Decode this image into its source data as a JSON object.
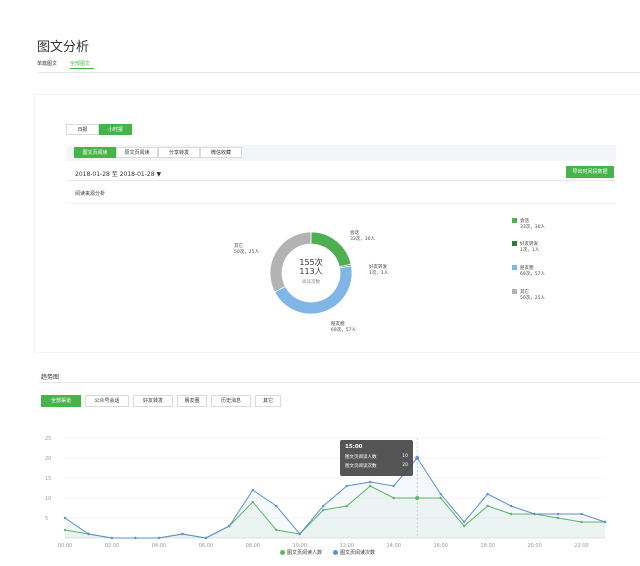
{
  "page": {
    "title": "图文分析"
  },
  "main_tabs": [
    {
      "label": "单篇图文",
      "active": false
    },
    {
      "label": "全部图文",
      "active": true
    }
  ],
  "period_buttons": [
    {
      "label": "日报",
      "active": false
    },
    {
      "label": "小时报",
      "active": true
    }
  ],
  "sub_tabs": [
    {
      "label": "图文页阅读",
      "active": true
    },
    {
      "label": "原文页阅读",
      "active": false
    },
    {
      "label": "分享转发",
      "active": false
    },
    {
      "label": "微信收藏",
      "active": false
    }
  ],
  "date_range": "2018-01-28 至 2018-01-28 ▼",
  "export_label": "导出时间段数据",
  "source_section": {
    "title": "阅读来源分析"
  },
  "donut": {
    "center_count": "155次",
    "center_people": "113人",
    "center_caption": "阅读次数",
    "slices": [
      {
        "name": "会话",
        "detail": "33次，30人",
        "value": 33,
        "color": "#4caf50"
      },
      {
        "name": "好友转发",
        "detail": "1次，1人",
        "value": 1,
        "color": "#2e7d32"
      },
      {
        "name": "朋友圈",
        "detail": "69次，57人",
        "value": 69,
        "color": "#7fb6e6"
      },
      {
        "name": "其它",
        "detail": "50次，25人",
        "value": 50,
        "color": "#b3b3b3"
      }
    ]
  },
  "trend": {
    "title": "趋势图",
    "tabs": [
      {
        "label": "全部渠道",
        "active": true
      },
      {
        "label": "公众号会话",
        "active": false
      },
      {
        "label": "好友转发",
        "active": false
      },
      {
        "label": "朋友圈",
        "active": false
      },
      {
        "label": "历史消息",
        "active": false
      },
      {
        "label": "其它",
        "active": false
      }
    ],
    "tooltip": {
      "time": "15:00",
      "rows": [
        {
          "label": "图文页阅读人数",
          "value": "10"
        },
        {
          "label": "图文页阅读次数",
          "value": "20"
        }
      ]
    },
    "legend": [
      {
        "label": "图文页阅读人数",
        "color": "#5cb85c"
      },
      {
        "label": "图文页阅读次数",
        "color": "#5b8fd6"
      }
    ]
  },
  "chart_data": {
    "type": "line",
    "title": "",
    "xlabel": "",
    "ylabel": "",
    "ylim": [
      0,
      25
    ],
    "yticks": [
      5,
      10,
      15,
      20,
      25
    ],
    "x": [
      "00:00",
      "01:00",
      "02:00",
      "03:00",
      "04:00",
      "05:00",
      "06:00",
      "07:00",
      "08:00",
      "09:00",
      "10:00",
      "11:00",
      "12:00",
      "13:00",
      "14:00",
      "15:00",
      "16:00",
      "17:00",
      "18:00",
      "19:00",
      "20:00",
      "21:00",
      "22:00",
      "23:00"
    ],
    "xticks": [
      "00:00",
      "02:00",
      "04:00",
      "06:00",
      "08:00",
      "10:00",
      "12:00",
      "14:00",
      "16:00",
      "18:00",
      "20:00",
      "22:00"
    ],
    "grid": true,
    "legend_position": "bottom",
    "series": [
      {
        "name": "图文页阅读人数",
        "color": "#5cb85c",
        "values": [
          2,
          1,
          0,
          0,
          0,
          1,
          0,
          3,
          9,
          2,
          1,
          7,
          8,
          13,
          10,
          10,
          10,
          3,
          8,
          6,
          6,
          5,
          4,
          4
        ]
      },
      {
        "name": "图文页阅读次数",
        "color": "#5b8fd6",
        "values": [
          5,
          1,
          0,
          0,
          0,
          1,
          0,
          3,
          12,
          8,
          1,
          8,
          13,
          14,
          13,
          20,
          11,
          4,
          11,
          8,
          6,
          6,
          6,
          4
        ]
      }
    ]
  }
}
